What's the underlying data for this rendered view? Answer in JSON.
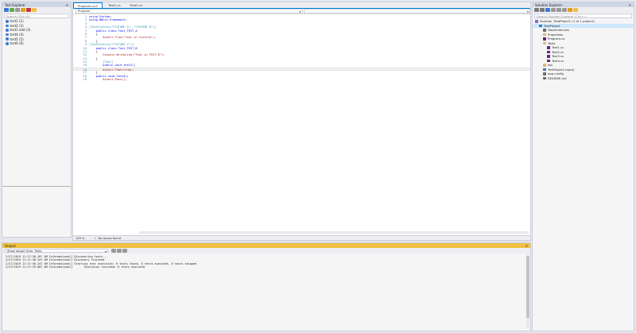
{
  "test_explorer": {
    "title": "Test Explorer",
    "search_placeholder": "Search (Ctrl+E)",
    "tests": [
      "test1 (1)",
      "test2 (2)",
      "test3 add (3)",
      "test4 (4)",
      "test5 (5)",
      "test6 (6)"
    ]
  },
  "editor": {
    "tabs": [
      "Program.cs",
      "Test1.cs",
      "Test2.cs"
    ],
    "nav_left": "Program",
    "lines": [
      {
        "n": "1",
        "text": "using System;"
      },
      {
        "n": "2",
        "text": "using NUnit.Framework;"
      },
      {
        "n": "3",
        "text": ""
      },
      {
        "n": "4",
        "text": "[TestFixture(\"FIXTURE A\", \"FIXTURE B\")]"
      },
      {
        "n": "5",
        "text": "    public class Test_TEST_A"
      },
      {
        "n": "6",
        "text": "    {"
      },
      {
        "n": "7",
        "text": "        Assert.True(\"Test in fixture\");"
      },
      {
        "n": "8",
        "text": "    }"
      },
      {
        "n": "9",
        "text": "[TestFixture(\"FIXTURE C\")]"
      },
      {
        "n": "10",
        "text": "    public class Test_TEST_B"
      },
      {
        "n": "11",
        "text": "    {"
      },
      {
        "n": "12",
        "text": "        Console.WriteLine(\"Test in TEST_B\");"
      },
      {
        "n": "13",
        "text": "    }"
      },
      {
        "n": "14",
        "text": "        [Test]"
      },
      {
        "n": "15",
        "text": "        public void test3()"
      },
      {
        "n": "16",
        "text": "        Assert.That(true);"
      },
      {
        "n": "17",
        "text": "    }"
      },
      {
        "n": "18",
        "text": "    public void test4()"
      },
      {
        "n": "19",
        "text": "        Assert.Pass();"
      }
    ],
    "status_zoom": "100 %",
    "status_issues": "No issues found"
  },
  "solution_explorer": {
    "title": "Solution Explorer",
    "search_placeholder": "Search Solution Explorer (Ctrl+;)",
    "items": [
      {
        "label": "Solution 'TestProject' (1 of 1 project)",
        "icon": "sln",
        "indent": 0,
        "selected": false
      },
      {
        "label": "TestProject",
        "icon": "prj",
        "indent": 1,
        "selected": true
      },
      {
        "label": "Dependencies",
        "icon": "ref",
        "indent": 2,
        "selected": false
      },
      {
        "label": "Properties",
        "icon": "folder",
        "indent": 2,
        "selected": false
      },
      {
        "label": "Program.cs",
        "icon": "cs",
        "indent": 2,
        "selected": false
      },
      {
        "label": "Tests",
        "icon": "folder",
        "indent": 2,
        "selected": false
      },
      {
        "label": "Test1.cs",
        "icon": "cs",
        "indent": 3,
        "selected": false
      },
      {
        "label": "Test2.cs",
        "icon": "cs",
        "indent": 3,
        "selected": false
      },
      {
        "label": "Test3.cs",
        "icon": "cs",
        "indent": 3,
        "selected": false
      },
      {
        "label": "Test4.cs",
        "icon": "cs",
        "indent": 3,
        "selected": false
      },
      {
        "label": "obj",
        "icon": "folder",
        "indent": 2,
        "selected": false
      },
      {
        "label": "TestProject.csproj",
        "icon": "prj",
        "indent": 2,
        "selected": false
      },
      {
        "label": "app.config",
        "icon": "ref",
        "indent": 2,
        "selected": false
      },
      {
        "label": "README.md",
        "icon": "ref",
        "indent": 2,
        "selected": false
      }
    ]
  },
  "output": {
    "title": "Output",
    "source": "Show output from: Tests",
    "lines": [
      "2/27/2019 11:17:58.207 AM Informational] Discovering tests...",
      "2/27/2019 11:17:58.347 AM Informational] Discovery finished",
      "2/27/2019 11:17:58.347 AM Informational] Starting test execution: 6 tests found, 6 tests executed, 0 tests skipped",
      "2/27/2019 11:17:59.007 AM Informational]       Execution finished: 6 tests executed"
    ]
  },
  "colors": {
    "accent": "#007acc",
    "output_title": "#f0c040"
  }
}
